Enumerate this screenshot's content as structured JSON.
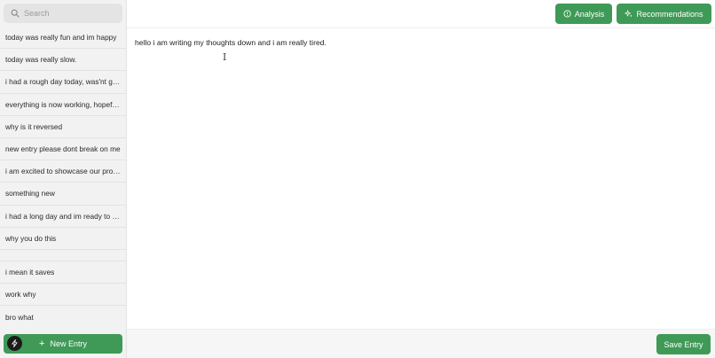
{
  "sidebar": {
    "search_placeholder": "Search",
    "entries": [
      "today was really fun and im happy",
      "today was really slow.",
      "i had a rough day today, was'nt great",
      "everything is now working, hopefully",
      "why is it reversed",
      "new entry please dont break on me",
      "i am excited to showcase our project",
      "something new",
      "i had a long day and im ready to sleep",
      "why you do this",
      "",
      "i mean it saves",
      "work why",
      "bro what"
    ],
    "new_entry_label": "New Entry"
  },
  "toolbar": {
    "analysis_label": "Analysis",
    "recommendations_label": "Recommendations"
  },
  "editor": {
    "content": "hello i am writing my thoughts down and i am really tired."
  },
  "footer": {
    "save_label": "Save Entry"
  },
  "colors": {
    "accent_green": "#3f9a57",
    "sidebar_bg": "#f2f2f2"
  },
  "icons": [
    "search-icon",
    "info-icon",
    "sparkles-icon",
    "plus-icon",
    "bolt-icon",
    "text-cursor-icon"
  ]
}
